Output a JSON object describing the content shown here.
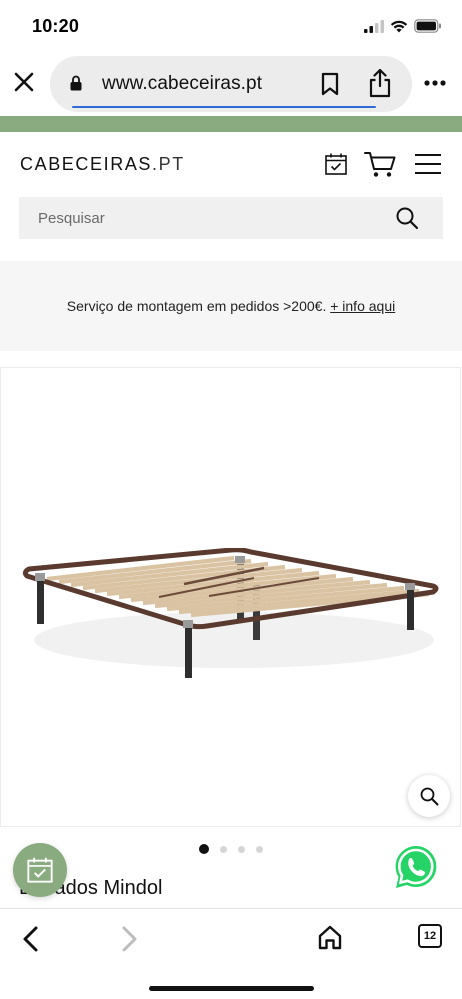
{
  "status_bar": {
    "time": "10:20",
    "icons": [
      "cellular-signal-icon",
      "wifi-icon",
      "battery-icon"
    ]
  },
  "browser": {
    "url": "www.cabeceiras.pt",
    "icons": [
      "close-icon",
      "lock-icon",
      "bookmark-icon",
      "share-icon",
      "more-icon"
    ]
  },
  "site": {
    "brand_color": "#8aaa80",
    "logo_main": "CABECEIRAS",
    "logo_suffix": ".PT",
    "header_icons": [
      "calendar-check-icon",
      "cart-icon",
      "hamburger-menu-icon"
    ]
  },
  "search": {
    "placeholder": "Pesquisar"
  },
  "promo": {
    "text": "Serviço de montagem em pedidos >200€.",
    "link_text": "+ info aqui"
  },
  "product": {
    "title": "Estrados Mindol",
    "image": "bed-frame-slatted-base",
    "gallery_total": 4,
    "gallery_active": 1
  },
  "floating": {
    "calendar_icon": "calendar-check-icon",
    "whatsapp_icon": "whatsapp-icon",
    "whatsapp_color": "#25d366"
  },
  "toolbar": {
    "tabs_count": "12",
    "icons": [
      "back-arrow-icon",
      "forward-arrow-icon",
      "home-icon",
      "tabs-icon"
    ]
  }
}
